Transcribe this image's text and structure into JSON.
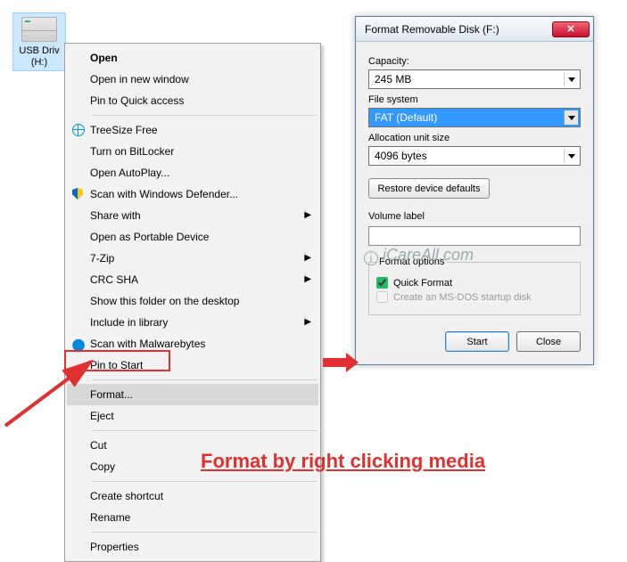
{
  "desktop_icon": {
    "line1": "USB Driv",
    "line2": "(H:)"
  },
  "context_menu": {
    "items": [
      {
        "label": "Open",
        "default": true
      },
      {
        "label": "Open in new window"
      },
      {
        "label": "Pin to Quick access"
      },
      {
        "sep": true
      },
      {
        "label": "TreeSize Free",
        "icon": "globe"
      },
      {
        "label": "Turn on BitLocker"
      },
      {
        "label": "Open AutoPlay..."
      },
      {
        "label": "Scan with Windows Defender...",
        "icon": "shield"
      },
      {
        "label": "Share with",
        "submenu": true
      },
      {
        "label": "Open as Portable Device"
      },
      {
        "label": "7-Zip",
        "submenu": true
      },
      {
        "label": "CRC SHA",
        "submenu": true
      },
      {
        "label": "Show this folder on the desktop"
      },
      {
        "label": "Include in library",
        "submenu": true
      },
      {
        "label": "Scan with Malwarebytes",
        "icon": "mb"
      },
      {
        "label": "Pin to Start"
      },
      {
        "sep": true
      },
      {
        "label": "Format...",
        "hovered": true
      },
      {
        "label": "Eject"
      },
      {
        "sep": true
      },
      {
        "label": "Cut"
      },
      {
        "label": "Copy"
      },
      {
        "sep": true
      },
      {
        "label": "Create shortcut"
      },
      {
        "label": "Rename"
      },
      {
        "sep": true
      },
      {
        "label": "Properties"
      }
    ]
  },
  "dialog": {
    "title": "Format Removable Disk (F:)",
    "capacity_label": "Capacity:",
    "capacity_value": "245 MB",
    "filesystem_label": "File system",
    "filesystem_value": "FAT (Default)",
    "alloc_label": "Allocation unit size",
    "alloc_value": "4096 bytes",
    "restore_label": "Restore device defaults",
    "volume_label": "Volume label",
    "format_options_legend": "Format options",
    "quick_format_label": "Quick Format",
    "msdos_label": "Create an MS-DOS startup disk",
    "start_label": "Start",
    "close_label": "Close"
  },
  "watermark": "iCareAll.com",
  "caption": "Format by right clicking media"
}
